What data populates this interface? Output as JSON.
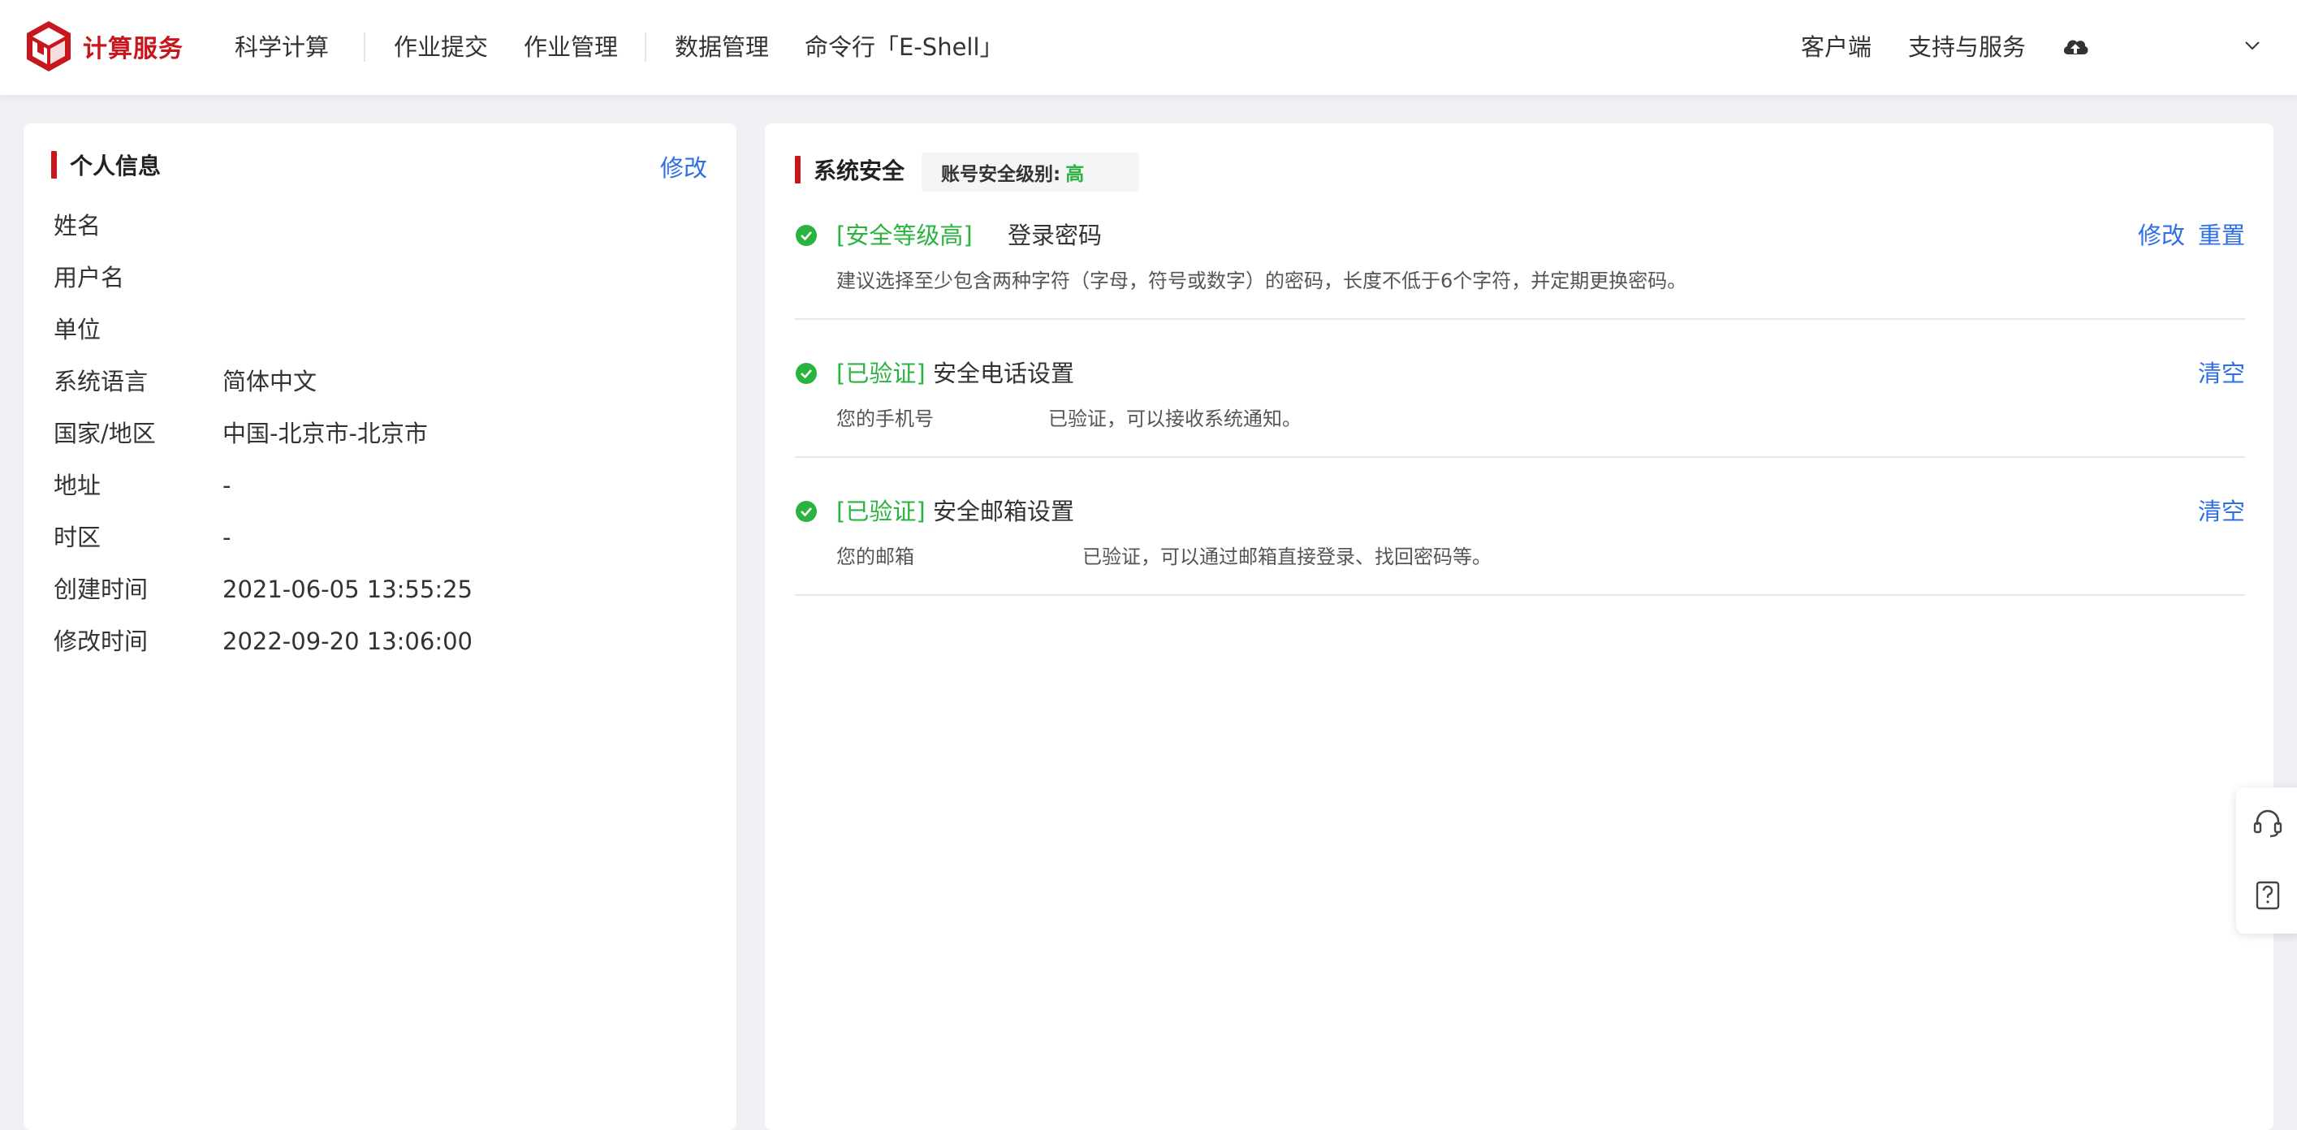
{
  "header": {
    "logo_text": "计算服务",
    "nav": [
      "科学计算",
      "作业提交",
      "作业管理",
      "数据管理",
      "命令行「E-Shell」"
    ],
    "right": [
      "客户端",
      "支持与服务"
    ],
    "icons": [
      "cloud-upload-icon",
      "chevron-down-icon"
    ]
  },
  "profile": {
    "title": "个人信息",
    "edit_label": "修改",
    "rows": [
      {
        "label": "姓名",
        "value": ""
      },
      {
        "label": "用户名",
        "value": ""
      },
      {
        "label": "单位",
        "value": ""
      },
      {
        "label": "系统语言",
        "value": "简体中文"
      },
      {
        "label": "国家/地区",
        "value": "中国-北京市-北京市"
      },
      {
        "label": "地址",
        "value": "-"
      },
      {
        "label": "时区",
        "value": "-"
      },
      {
        "label": "创建时间",
        "value": "2021-06-05 13:55:25"
      },
      {
        "label": "修改时间",
        "value": "2022-09-20 13:06:00"
      }
    ]
  },
  "security": {
    "title": "系统安全",
    "level_label": "账号安全级别:",
    "level_value": "高",
    "items": [
      {
        "status": "[安全等级高]",
        "name": "登录密码",
        "desc": "建议选择至少包含两种字符（字母，符号或数字）的密码，长度不低于6个字符，并定期更换密码。",
        "desc2": "",
        "actions": [
          "修改",
          "重置"
        ]
      },
      {
        "status": "[已验证]",
        "name": "安全电话设置",
        "desc": "您的手机号",
        "desc2": "已验证，可以接收系统通知。",
        "actions": [
          "清空"
        ]
      },
      {
        "status": "[已验证]",
        "name": "安全邮箱设置",
        "desc": "您的邮箱",
        "desc2": "已验证，可以通过邮箱直接登录、找回密码等。",
        "actions": [
          "清空"
        ]
      }
    ]
  },
  "float_widget": {
    "icons": [
      "headset-icon",
      "help-document-icon"
    ]
  },
  "colors": {
    "brand": "#c8161d",
    "link": "#2f6fe6",
    "success": "#2ab33f"
  }
}
